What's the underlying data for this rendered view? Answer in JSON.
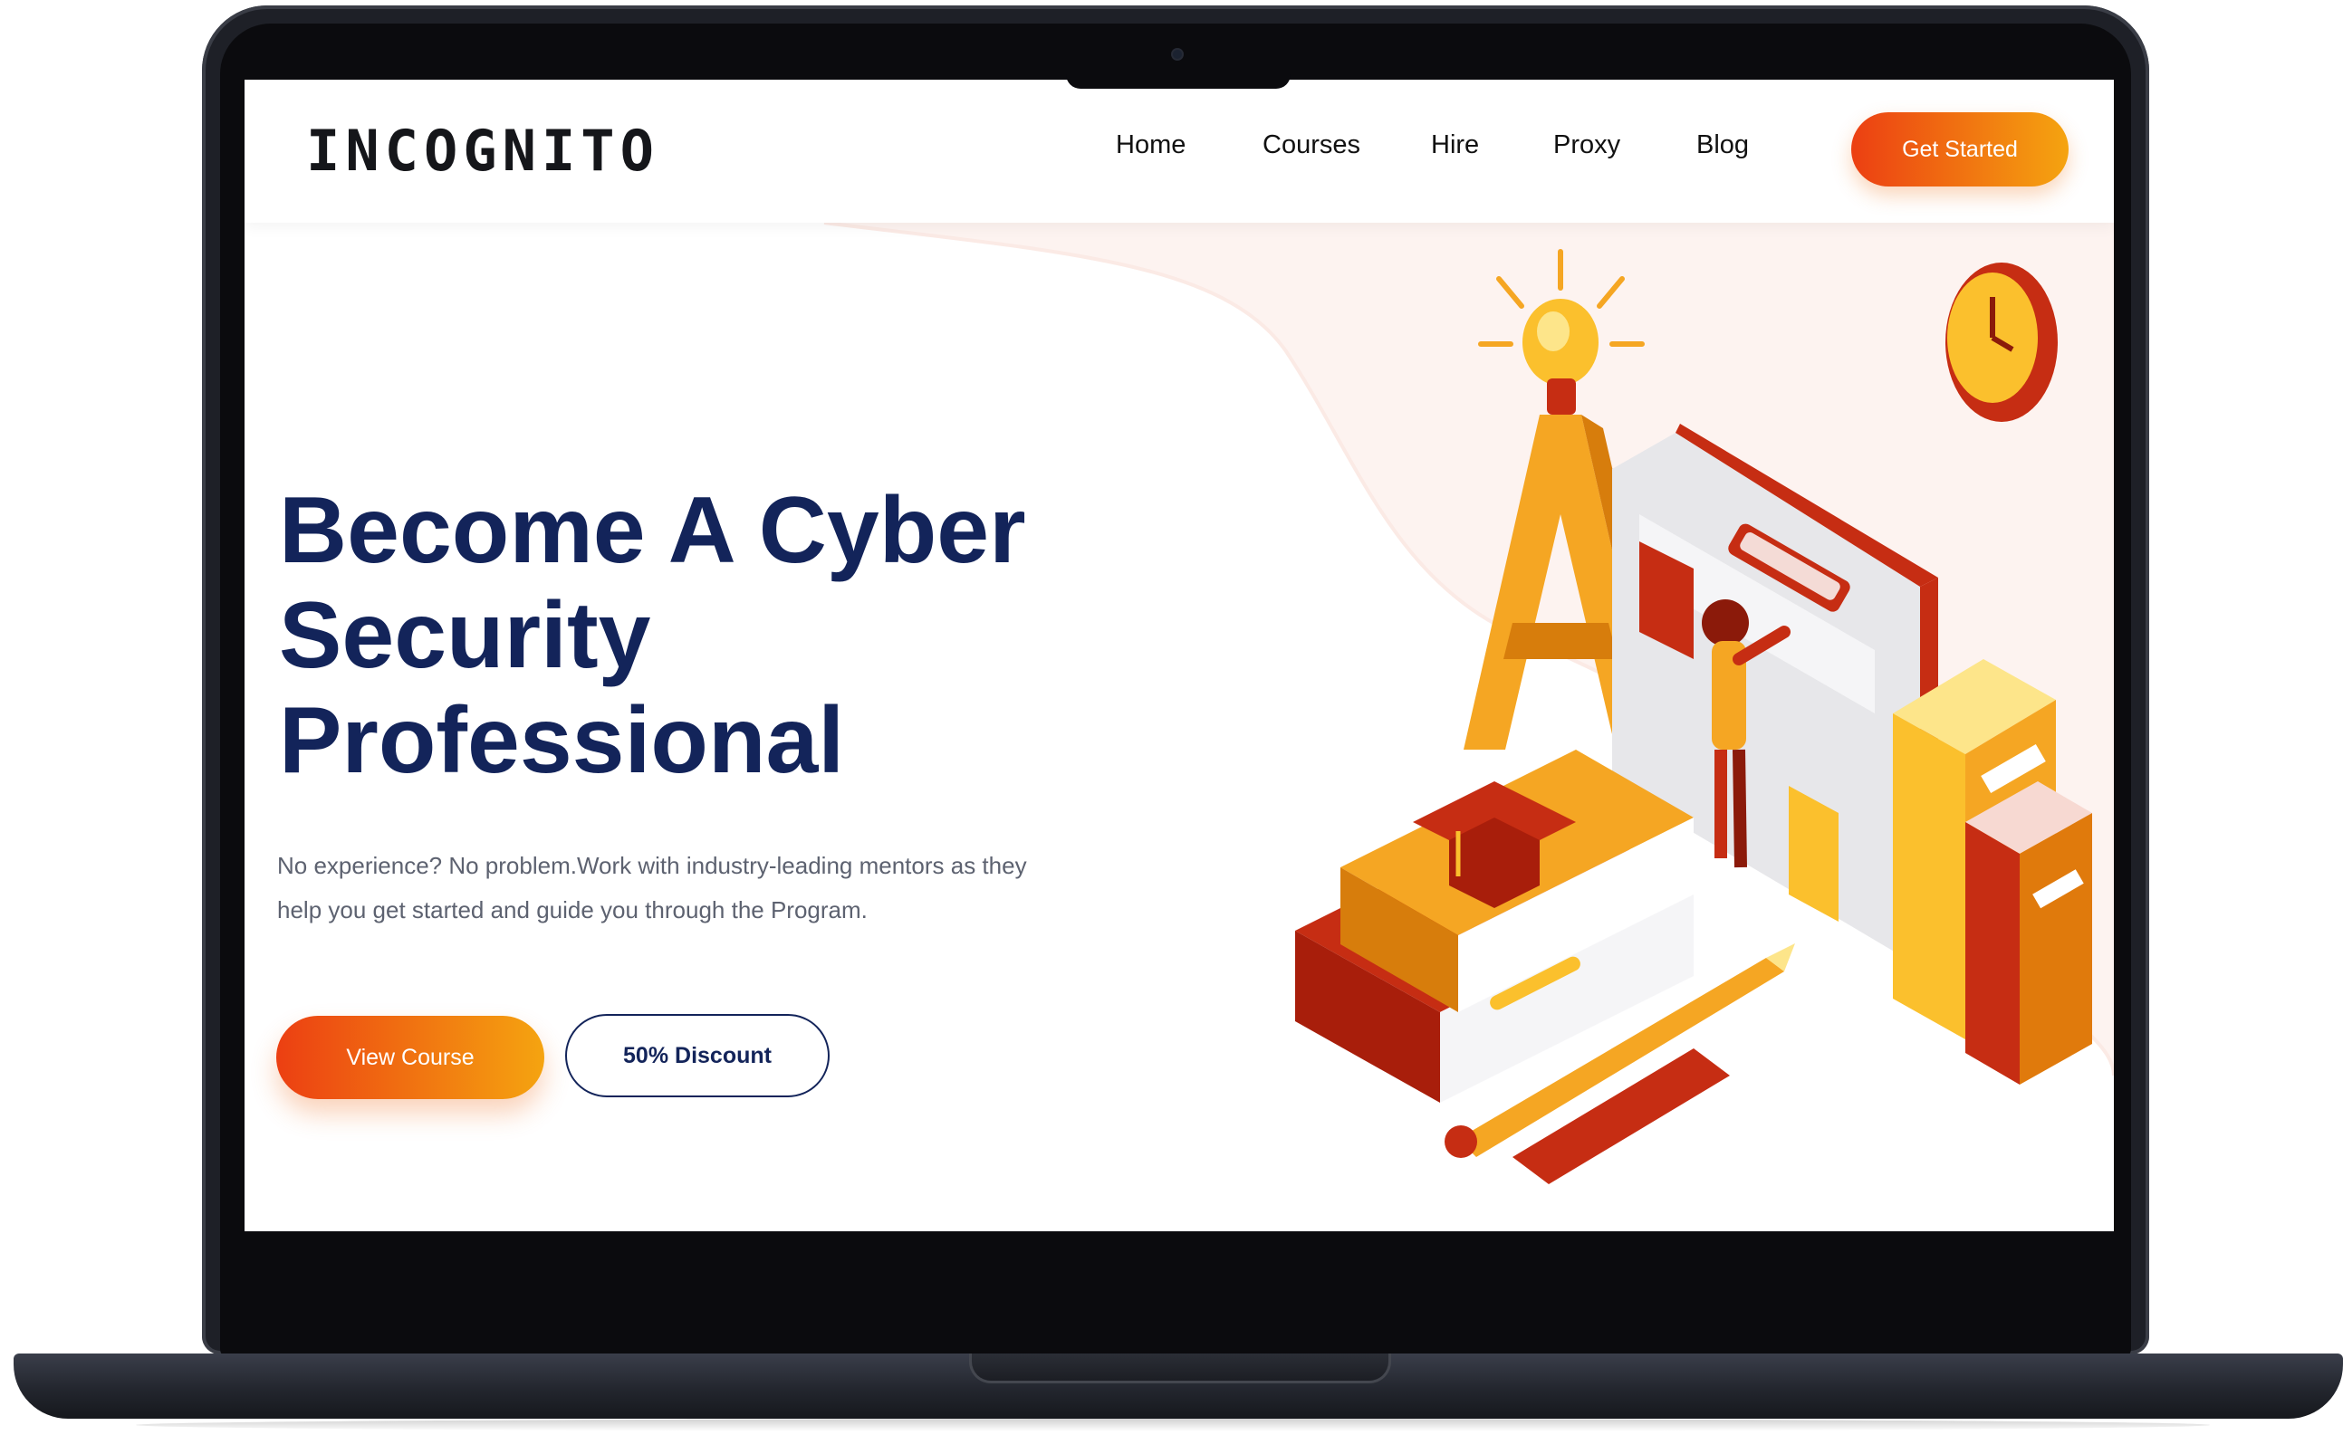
{
  "nav": {
    "logo": "INCOGNITO",
    "links": [
      "Home",
      "Courses",
      "Hire",
      "Proxy",
      "Blog"
    ],
    "cta": "Get Started"
  },
  "hero": {
    "title_lines": [
      "Become A Cyber",
      "Security",
      "Professional"
    ],
    "subtitle_lines": [
      "No experience? No problem.Work with industry-leading mentors as they",
      "help you get started and guide you through the Program."
    ],
    "primary_button": "View Course",
    "secondary_button": "50% Discount"
  },
  "colors": {
    "accent_start": "#ec3f12",
    "accent_end": "#f5a410",
    "heading": "#13245a",
    "laptop": "#1e2027"
  }
}
